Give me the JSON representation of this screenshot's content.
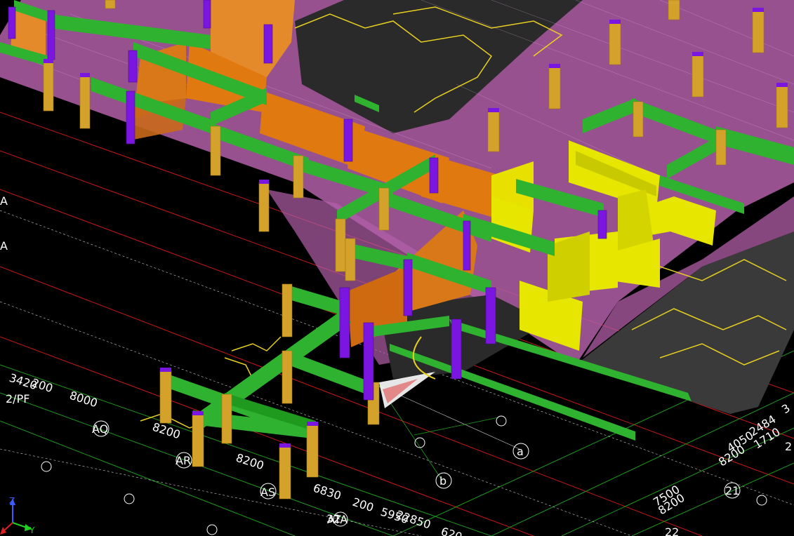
{
  "viewport": {
    "background": "#000000",
    "colors": {
      "beam": "#2fb22f",
      "beam_dark": "#1f8c1f",
      "column_gold": "#d4a22a",
      "column_purple": "#7a16e0",
      "wall_orange": "#e07a10",
      "wall_yellow": "#e6e600",
      "slab_pink": "#c070b8",
      "grid_red": "#d02020",
      "grid_green": "#20a020",
      "grid_white": "#dddddd"
    }
  },
  "axis_labels": {
    "AQ": "AQ",
    "AR": "AR",
    "AS": "AS",
    "A_top": "A",
    "A_mid": "A",
    "ATA": "ATA",
    "a": "a",
    "b": "b",
    "n21": "21",
    "n22": "22",
    "n2": "2",
    "n2PF": "2/PF",
    "n32": "32"
  },
  "dimension_labels": {
    "d3420": "3420",
    "d200a": "200",
    "d8000": "8000",
    "d8200a": "8200",
    "d8200b": "8200",
    "d6830": "6830",
    "d200b": "200",
    "d5950": "5950",
    "d22850": "22850",
    "d620": "620",
    "d7500": "7500",
    "d8200c": "8200",
    "d8200d": "8200",
    "d4050": "4050",
    "d2484": "2484",
    "d1710": "1710",
    "d3": "3"
  },
  "ucs_icon": {
    "z": "Z",
    "y": "Y",
    "x": "X"
  }
}
